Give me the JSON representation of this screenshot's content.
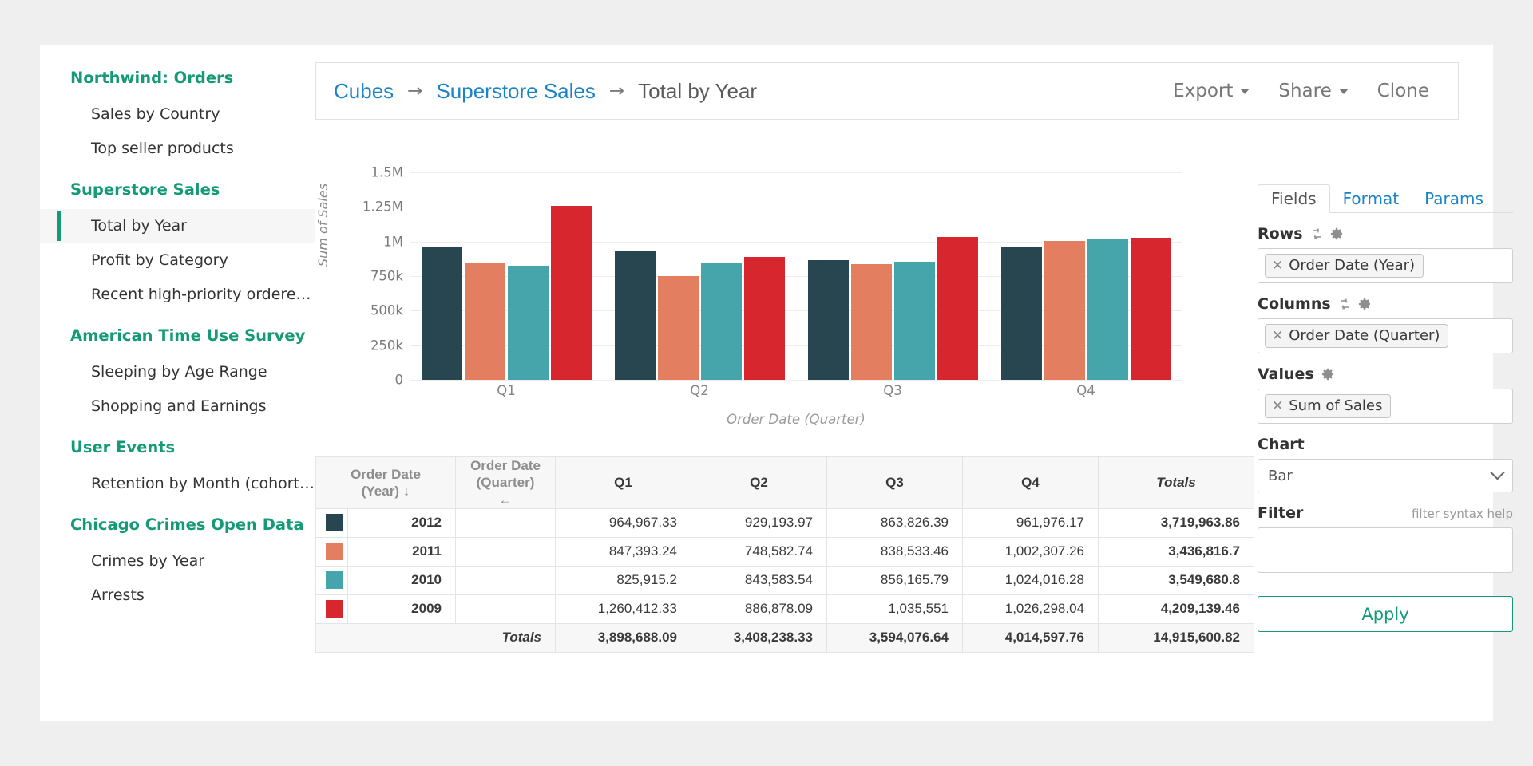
{
  "sidebar": {
    "groups": [
      {
        "title": "Northwind: Orders",
        "items": [
          {
            "label": "Sales by Country",
            "active": false
          },
          {
            "label": "Top seller products",
            "active": false
          }
        ]
      },
      {
        "title": "Superstore Sales",
        "items": [
          {
            "label": "Total by Year",
            "active": true
          },
          {
            "label": "Profit by Category",
            "active": false
          },
          {
            "label": "Recent high-priority ordere…",
            "active": false
          }
        ]
      },
      {
        "title": "American Time Use Survey",
        "items": [
          {
            "label": "Sleeping by Age Range",
            "active": false
          },
          {
            "label": "Shopping and Earnings",
            "active": false
          }
        ]
      },
      {
        "title": "User Events",
        "items": [
          {
            "label": "Retention by Month (cohort…",
            "active": false
          }
        ]
      },
      {
        "title": "Chicago Crimes Open Data",
        "items": [
          {
            "label": "Crimes by Year",
            "active": false
          },
          {
            "label": "Arrests",
            "active": false
          }
        ]
      }
    ]
  },
  "header": {
    "breadcrumb": [
      {
        "label": "Cubes",
        "link": true
      },
      {
        "label": "Superstore Sales",
        "link": true
      },
      {
        "label": "Total by Year",
        "link": false
      }
    ],
    "arrow": "→",
    "actions": [
      {
        "label": "Export",
        "caret": true
      },
      {
        "label": "Share",
        "caret": true
      },
      {
        "label": "Clone",
        "caret": false
      }
    ]
  },
  "chart_data": {
    "type": "bar",
    "title": "",
    "xlabel": "Order Date (Quarter)",
    "ylabel": "Sum of Sales",
    "categories": [
      "Q1",
      "Q2",
      "Q3",
      "Q4"
    ],
    "ylim": [
      0,
      1500000
    ],
    "yticks": [
      0,
      250000,
      500000,
      750000,
      1000000,
      1250000,
      1500000
    ],
    "ytick_labels": [
      "0",
      "250k",
      "500k",
      "750k",
      "1M",
      "1.25M",
      "1.5M"
    ],
    "grid": true,
    "legend": "none",
    "series": [
      {
        "name": "2012",
        "color": "#28464f",
        "values": [
          964967.33,
          929193.97,
          863826.39,
          961976.17
        ]
      },
      {
        "name": "2011",
        "color": "#e37f60",
        "values": [
          847393.24,
          748582.74,
          838533.46,
          1002307.26
        ]
      },
      {
        "name": "2010",
        "color": "#45a5ab",
        "values": [
          825915.2,
          843583.54,
          856165.79,
          1024016.28
        ]
      },
      {
        "name": "2009",
        "color": "#d8262f",
        "values": [
          1260412.33,
          886878.09,
          1035551,
          1026298.04
        ]
      }
    ]
  },
  "table": {
    "headers": {
      "year": "Order Date\n(Year) ↓",
      "year_line1": "Order Date",
      "year_line2": "(Year) ↓",
      "quarter_line1": "Order Date",
      "quarter_line2": "(Quarter) ←",
      "q1": "Q1",
      "q2": "Q2",
      "q3": "Q3",
      "q4": "Q4",
      "totals": "Totals"
    },
    "rows": [
      {
        "color": "#28464f",
        "year": "2012",
        "q1": "964,967.33",
        "q2": "929,193.97",
        "q3": "863,826.39",
        "q4": "961,976.17",
        "total": "3,719,963.86"
      },
      {
        "color": "#e37f60",
        "year": "2011",
        "q1": "847,393.24",
        "q2": "748,582.74",
        "q3": "838,533.46",
        "q4": "1,002,307.26",
        "total": "3,436,816.7"
      },
      {
        "color": "#45a5ab",
        "year": "2010",
        "q1": "825,915.2",
        "q2": "843,583.54",
        "q3": "856,165.79",
        "q4": "1,024,016.28",
        "total": "3,549,680.8"
      },
      {
        "color": "#d8262f",
        "year": "2009",
        "q1": "1,260,412.33",
        "q2": "886,878.09",
        "q3": "1,035,551",
        "q4": "1,026,298.04",
        "total": "4,209,139.46"
      }
    ],
    "totals_row": {
      "label": "Totals",
      "q1": "3,898,688.09",
      "q2": "3,408,238.33",
      "q3": "3,594,076.64",
      "q4": "4,014,597.76",
      "total": "14,915,600.82"
    }
  },
  "panel": {
    "tabs": [
      {
        "label": "Fields",
        "active": true
      },
      {
        "label": "Format",
        "active": false
      },
      {
        "label": "Params",
        "active": false
      }
    ],
    "rows_label": "Rows",
    "rows_pill": "Order Date (Year)",
    "columns_label": "Columns",
    "columns_pill": "Order Date (Quarter)",
    "values_label": "Values",
    "values_pill": "Sum of Sales",
    "chart_label": "Chart",
    "chart_value": "Bar",
    "filter_label": "Filter",
    "filter_help": "filter syntax help",
    "filter_value": "",
    "filter_placeholder": "",
    "apply_label": "Apply",
    "remove_glyph": "✕"
  },
  "colors": {
    "accent_green": "#159a78",
    "link_blue": "#1a84c7",
    "series": [
      "#28464f",
      "#e37f60",
      "#45a5ab",
      "#d8262f"
    ]
  }
}
